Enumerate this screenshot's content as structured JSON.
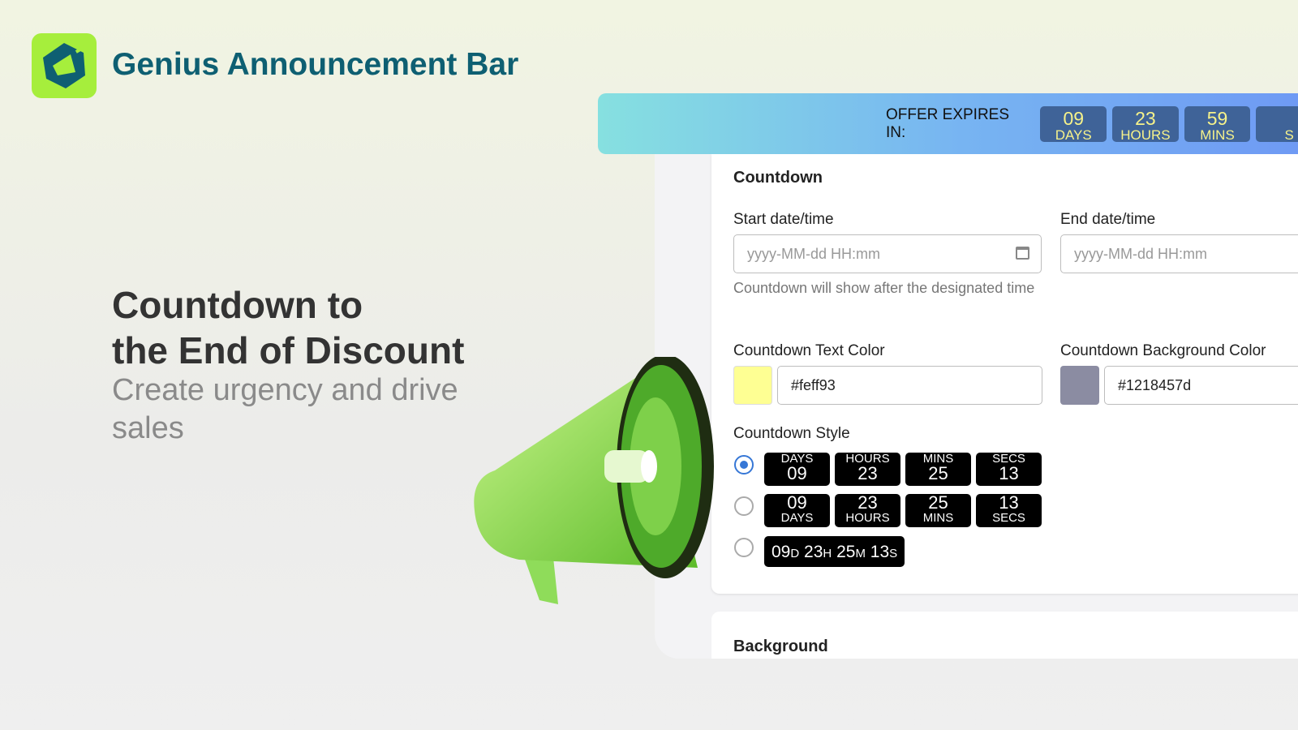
{
  "brand": {
    "name": "Genius Announcement Bar",
    "logo_color": "#a6ee3c"
  },
  "hero": {
    "title_line1": "Countdown to",
    "title_line2": "the End of Discount",
    "subtitle": "Create urgency and drive sales"
  },
  "bar": {
    "label": "OFFER EXPIRES IN:",
    "boxes": [
      {
        "n": "09",
        "u": "DAYS"
      },
      {
        "n": "23",
        "u": "HOURS"
      },
      {
        "n": "59",
        "u": "MINS"
      },
      {
        "n": "",
        "u": "S"
      }
    ]
  },
  "countdown": {
    "title": "Countdown",
    "start_label": "Start date/time",
    "start_placeholder": "yyyy-MM-dd HH:mm",
    "start_help": "Countdown will show after the designated time",
    "end_label": "End date/time",
    "end_placeholder": "yyyy-MM-dd HH:mm",
    "text_color_label": "Countdown Text Color",
    "text_color": "#feff93",
    "bg_color_label": "Countdown Background Color",
    "bg_color": "#1218457d",
    "style_label": "Countdown Style",
    "style1": [
      {
        "u": "DAYS",
        "n": "09"
      },
      {
        "u": "HOURS",
        "n": "23"
      },
      {
        "u": "MINS",
        "n": "25"
      },
      {
        "u": "SECS",
        "n": "13"
      }
    ],
    "style2": [
      {
        "n": "09",
        "u": "DAYS"
      },
      {
        "n": "23",
        "u": "HOURS"
      },
      {
        "n": "25",
        "u": "MINS"
      },
      {
        "n": "13",
        "u": "SECS"
      }
    ],
    "style3": [
      {
        "n": "09",
        "u": "D"
      },
      {
        "n": "23",
        "u": "H"
      },
      {
        "n": "25",
        "u": "M"
      },
      {
        "n": "13",
        "u": "S"
      }
    ],
    "selected_style": 1
  },
  "background": {
    "title": "Background"
  }
}
